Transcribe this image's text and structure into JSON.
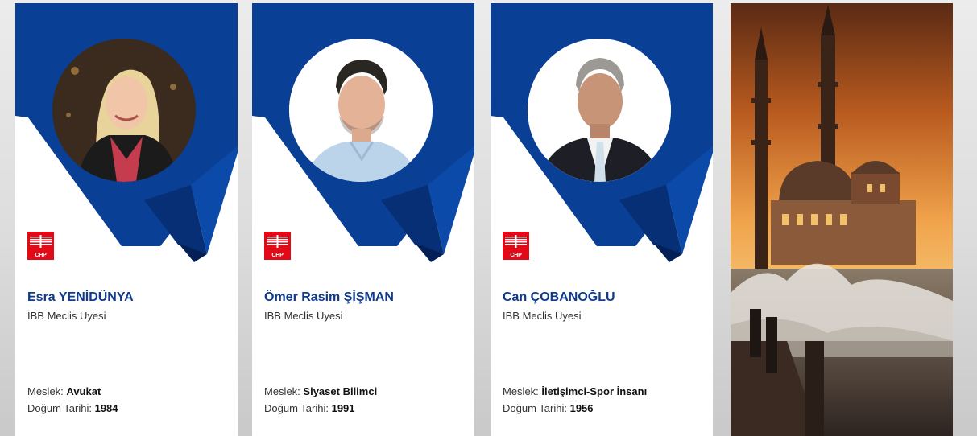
{
  "members": [
    {
      "name": "Esra YENİDÜNYA",
      "role": "İBB Meclis Üyesi",
      "job_label": "Meslek:",
      "job": "Avukat",
      "birth_label": "Doğum Tarihi:",
      "birth_year": "1984",
      "party_logo_text": "CHP"
    },
    {
      "name": "Ömer Rasim ŞİŞMAN",
      "role": "İBB Meclis Üyesi",
      "job_label": "Meslek:",
      "job": "Siyaset Bilimci",
      "birth_label": "Doğum Tarihi:",
      "birth_year": "1991",
      "party_logo_text": "CHP"
    },
    {
      "name": "Can ÇOBANOĞLU",
      "role": "İBB Meclis Üyesi",
      "job_label": "Meslek:",
      "job": "İletişimci-Spor İnsanı",
      "birth_label": "Doğum Tarihi:",
      "birth_year": "1956",
      "party_logo_text": "CHP"
    }
  ],
  "colors": {
    "brand_blue": "#0d3a8b",
    "banner_blue": "#0a3f96",
    "party_red": "#e30a17",
    "page_background": "#dcdcdc"
  },
  "icons": [
    "chp-logo-icon"
  ]
}
